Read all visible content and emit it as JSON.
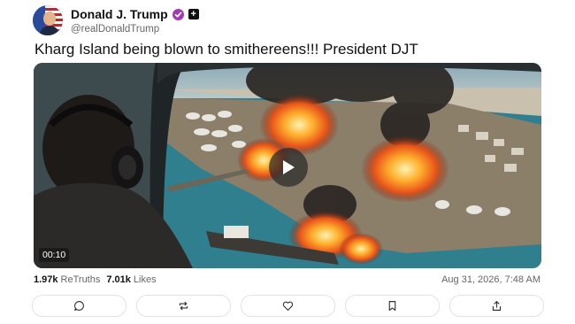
{
  "author": {
    "display_name": "Donald J. Trump",
    "handle": "@realDonaldTrump",
    "avatar_icon": "flag-portrait-avatar",
    "verified_icon": "verified-badge-icon",
    "plus_label": "+",
    "verified_color": "#a53ab5"
  },
  "post": {
    "text": "Kharg Island being blown to smithereens!!! President DJT",
    "video": {
      "duration": "00:10",
      "play_icon": "play-icon"
    }
  },
  "stats": {
    "retruths_count": "1.97k",
    "retruths_label": "ReTruths",
    "likes_count": "7.01k",
    "likes_label": "Likes",
    "timestamp": "Aug 31, 2026, 7:48 AM"
  },
  "actions": [
    {
      "icon": "comment-icon"
    },
    {
      "icon": "retruth-icon"
    },
    {
      "icon": "like-icon"
    },
    {
      "icon": "bookmark-icon"
    },
    {
      "icon": "share-icon"
    }
  ]
}
